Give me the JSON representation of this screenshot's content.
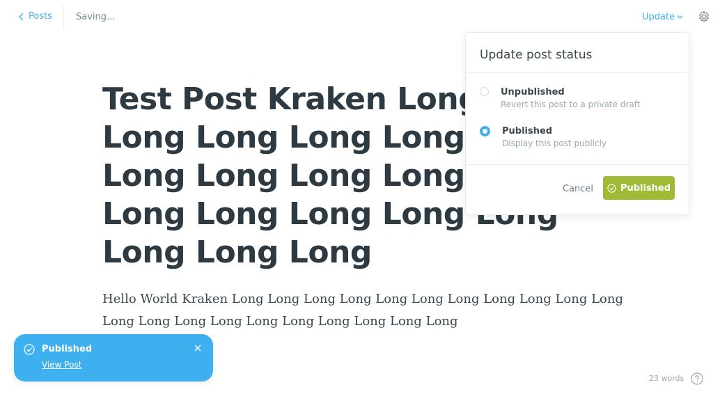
{
  "topbar": {
    "back_label": "Posts",
    "saving_label": "Saving...",
    "update_label": "Update",
    "icons": {
      "back": "chevron-left-icon",
      "update": "chevron-down-icon",
      "settings": "gear-icon"
    }
  },
  "editor": {
    "title": "Test Post Kraken Long Long Long Long Long Long Long Long Long Long Long Long Long Long Long Long Long Long Long Long",
    "body": "Hello World Kraken Long Long Long Long Long Long Long Long Long Long Long Long Long Long Long Long Long Long Long Long Long"
  },
  "popover": {
    "title": "Update post status",
    "options": [
      {
        "label": "Unpublished",
        "description": "Revert this post to a private draft",
        "selected": false
      },
      {
        "label": "Published",
        "description": "Display this post publicly",
        "selected": true
      }
    ],
    "cancel_label": "Cancel",
    "confirm_label": "Published"
  },
  "toast": {
    "title": "Published",
    "link_label": "View Post"
  },
  "footer": {
    "word_count": "23 words"
  },
  "colors": {
    "accent": "#3eb0ef",
    "success": "#9fbb35",
    "text": "#2e3a42",
    "muted": "#9aa7ae"
  }
}
